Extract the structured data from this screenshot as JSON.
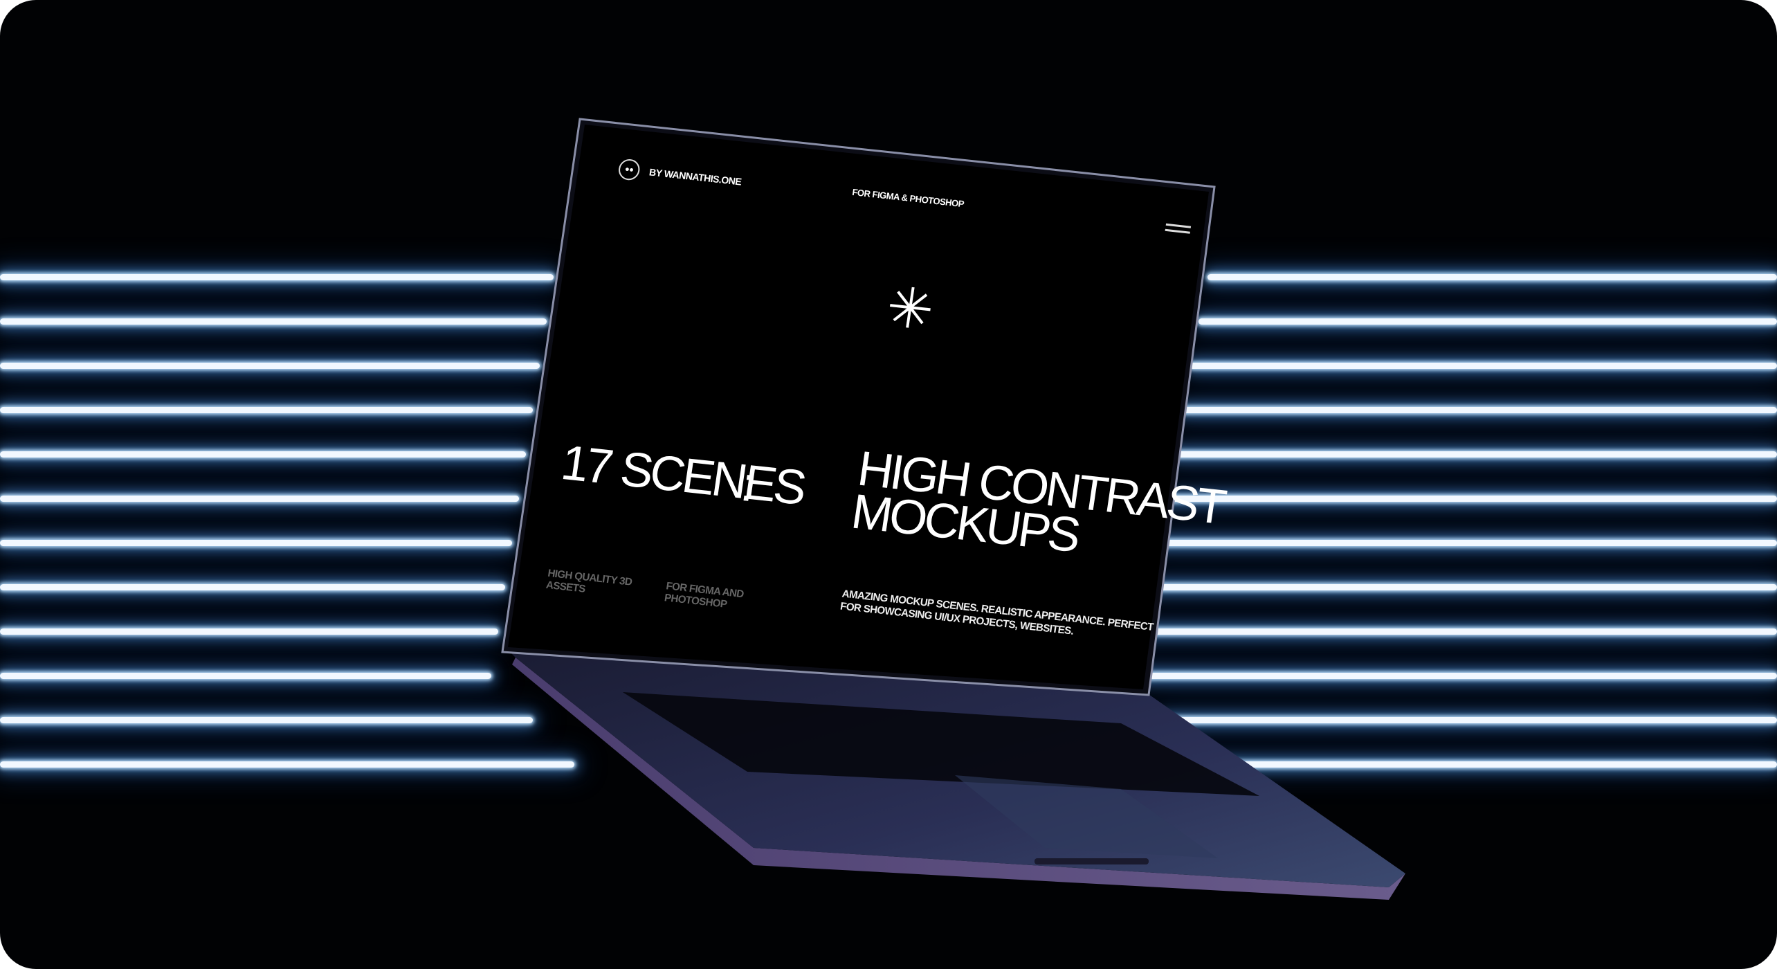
{
  "scene": {
    "background_color": "#010204",
    "neon_color": "#bfe3ff",
    "laptop_color": "#2a2d52"
  },
  "screen": {
    "brand": "BY WANNATHIS.ONE",
    "subtitle": "FOR FIGMA & PHOTOSHOP",
    "menu_icon": "hamburger-icon",
    "asterisk": "✳",
    "headline_left": "17 SCENES",
    "headline_colon": ":",
    "headline_right_line1": "HIGH CONTRAST",
    "headline_right_line2": "MOCKUPS",
    "feature1_line1": "HIGH QUALITY 3D",
    "feature1_line2": "ASSETS",
    "feature2_line1": "FOR FIGMA AND",
    "feature2_line2": "PHOTOSHOP",
    "description_line1": "AMAZING MOCKUP SCENES. REALISTIC APPEARANCE. PERFECT",
    "description_line2": "FOR SHOWCASING UI/UX PROJECTS, WEBSITES."
  }
}
